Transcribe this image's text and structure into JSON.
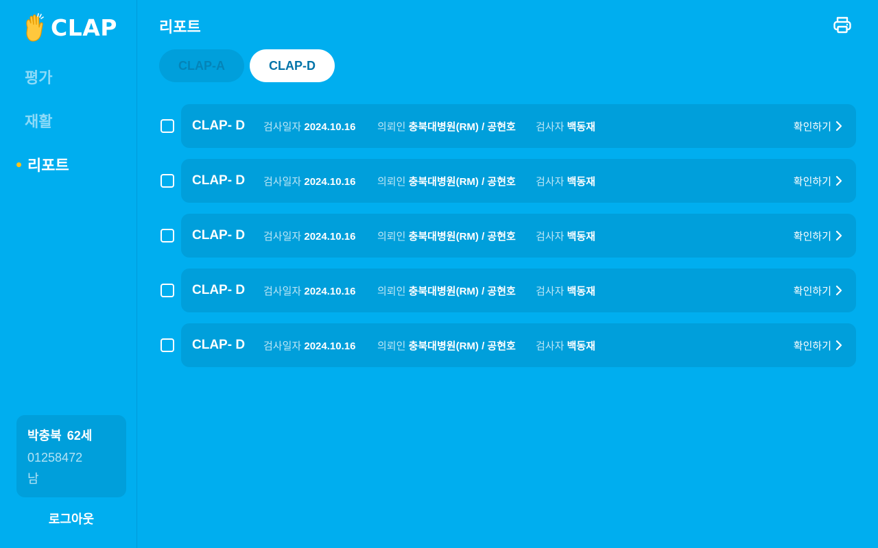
{
  "app": {
    "name": "CLAP"
  },
  "nav": {
    "items": [
      {
        "label": "평가",
        "active": false
      },
      {
        "label": "재활",
        "active": false
      },
      {
        "label": "리포트",
        "active": true
      }
    ]
  },
  "patient": {
    "name": "박충북",
    "age": "62세",
    "id": "01258472",
    "sex": "남"
  },
  "logout_label": "로그아웃",
  "page": {
    "title": "리포트"
  },
  "tabs": [
    {
      "label": "CLAP-A",
      "active": false
    },
    {
      "label": "CLAP-D",
      "active": true
    }
  ],
  "reports": {
    "labels": {
      "date": "검사일자",
      "requester": "의뢰인",
      "examiner": "검사자",
      "confirm": "확인하기"
    },
    "rows": [
      {
        "name": "CLAP- D",
        "date": "2024.10.16",
        "requester": "충북대병원(RM) / 공현호",
        "examiner": "백동재",
        "checked": false
      },
      {
        "name": "CLAP- D",
        "date": "2024.10.16",
        "requester": "충북대병원(RM) / 공현호",
        "examiner": "백동재",
        "checked": false
      },
      {
        "name": "CLAP- D",
        "date": "2024.10.16",
        "requester": "충북대병원(RM) / 공현호",
        "examiner": "백동재",
        "checked": false
      },
      {
        "name": "CLAP- D",
        "date": "2024.10.16",
        "requester": "충북대병원(RM) / 공현호",
        "examiner": "백동재",
        "checked": false
      },
      {
        "name": "CLAP- D",
        "date": "2024.10.16",
        "requester": "충북대병원(RM) / 공현호",
        "examiner": "백동재",
        "checked": false
      }
    ]
  },
  "icons": {
    "logo": "clapping-hand-icon",
    "print": "printer-icon",
    "chevron": "chevron-right-icon"
  },
  "colors": {
    "background": "#00AEEF",
    "card": "#009FDB",
    "accent_dot": "#FFC21A",
    "tab_active_text": "#0073A8"
  }
}
